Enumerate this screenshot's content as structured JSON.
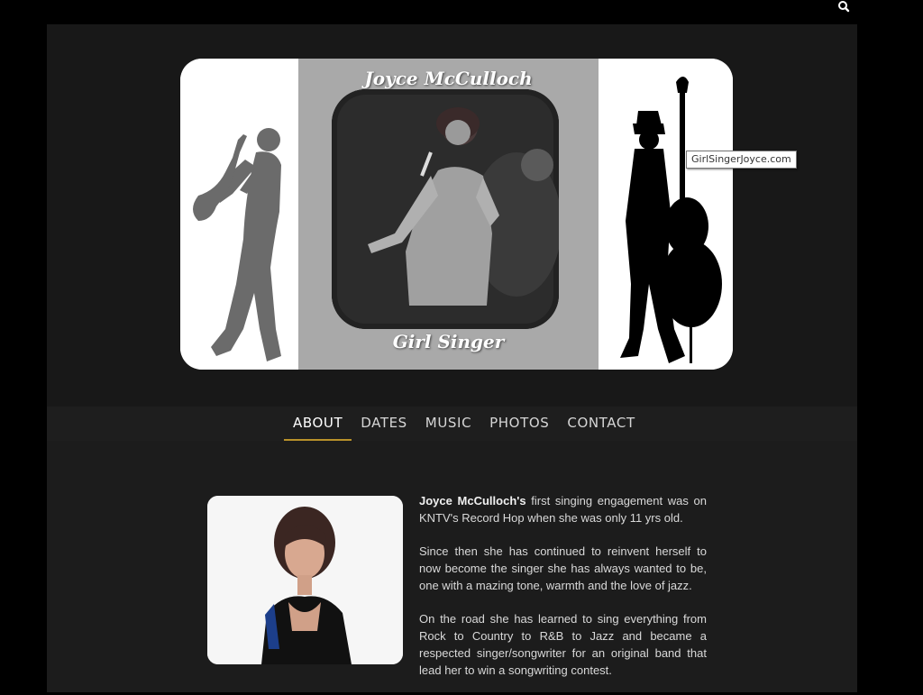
{
  "header": {
    "search_icon": "search-icon",
    "banner_name": "Joyce McCulloch",
    "banner_tagline": "Girl Singer",
    "tooltip": "GirlSingerJoyce.com"
  },
  "nav": {
    "items": [
      {
        "label": "ABOUT",
        "active": true
      },
      {
        "label": "DATES",
        "active": false
      },
      {
        "label": "MUSIC",
        "active": false
      },
      {
        "label": "PHOTOS",
        "active": false
      },
      {
        "label": "CONTACT",
        "active": false
      }
    ]
  },
  "about": {
    "p1_name": "Joyce McCulloch's",
    "p1_rest": " first singing engagement was on KNTV's Record Hop when she was only 11 yrs old.",
    "p2": "Since then she has continued to reinvent herself to now become the singer she has always wanted to be, one with a mazing tone, warmth and the love of jazz.",
    "p3": "On the road she has learned to sing everything from Rock to Country to R&B to Jazz and became a respected singer/songwriter for an original band that lead her to win a songwriting contest."
  },
  "colors": {
    "background": "#000000",
    "page": "#181818",
    "nav_accent": "#b8912a",
    "banner_center": "#a9a9a9"
  }
}
